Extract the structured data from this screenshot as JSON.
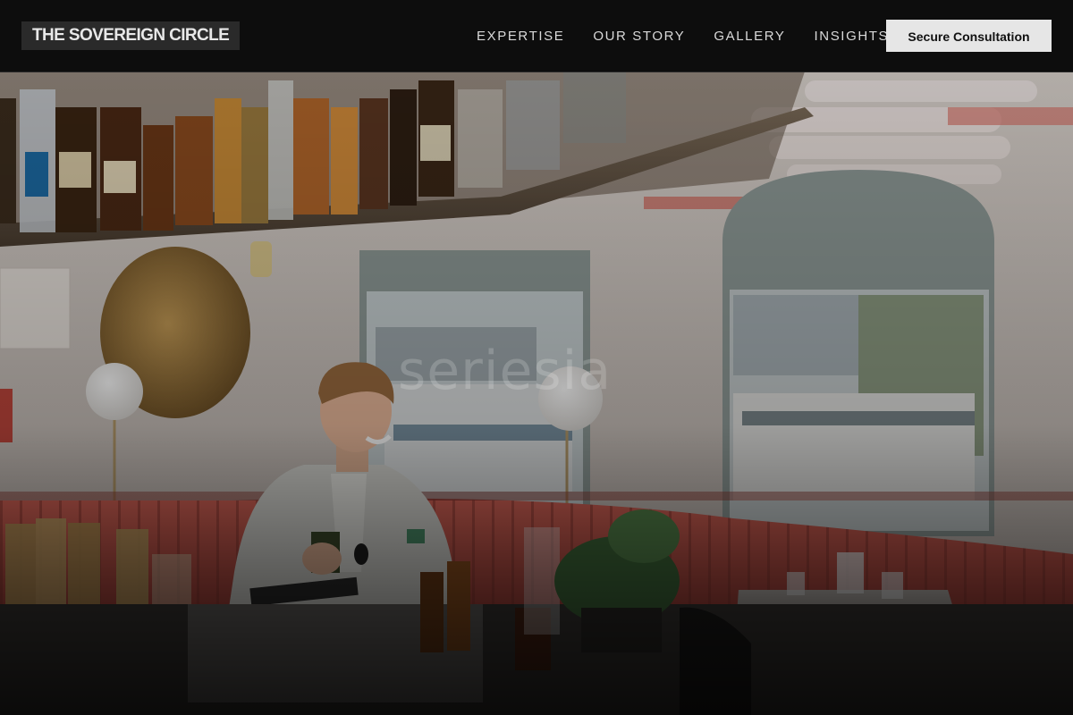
{
  "brand": {
    "name": "THE SOVEREIGN CIRCLE"
  },
  "nav": {
    "links": [
      {
        "label": "EXPERTISE"
      },
      {
        "label": "OUR STORY"
      },
      {
        "label": "GALLERY"
      },
      {
        "label": "INSIGHTS"
      }
    ],
    "cta_label": "Secure Consultation"
  },
  "hero": {
    "watermark_text": "seriesia"
  },
  "colors": {
    "nav_background": "#0d0d0d",
    "brand_box": "#2a2a2a",
    "cta_background": "#e6e6e6",
    "booth_velvet": "#c9574c"
  }
}
